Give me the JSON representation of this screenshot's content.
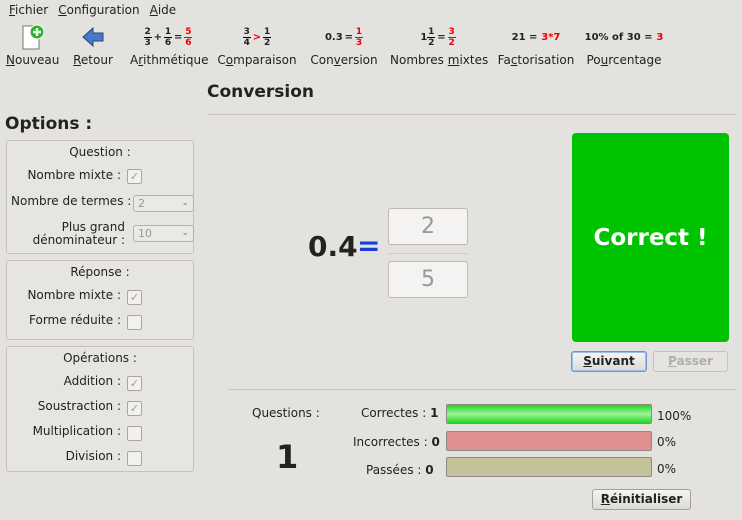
{
  "menu": {
    "items": [
      {
        "first": "F",
        "rest": "ichier"
      },
      {
        "first": "C",
        "rest": "onfiguration"
      },
      {
        "first": "A",
        "rest": "ide"
      }
    ]
  },
  "toolbar": {
    "new_label_first": "N",
    "new_label_rest": "ouveau",
    "back_label_first": "R",
    "back_label_rest": "etour",
    "arith_label_pre": "A",
    "arith_label_u": "r",
    "arith_label_rest": "ithmétique",
    "comp_label_pre": "C",
    "comp_label_u": "o",
    "comp_label_rest": "mparaison",
    "conv_label_pre": "Con",
    "conv_label_u": "v",
    "conv_label_rest": "ersion",
    "mixed_label_pre": "Nombres ",
    "mixed_label_u": "m",
    "mixed_label_rest": "ixtes",
    "fact_label_pre": "Fa",
    "fact_label_u": "c",
    "fact_label_rest": "torisation",
    "pct_label_pre": "Po",
    "pct_label_u": "u",
    "pct_label_rest": "rcentage",
    "arith_icon": {
      "a_num": "2",
      "a_den": "3",
      "plus": "+",
      "b_num": "1",
      "b_den": "6",
      "eq": "=",
      "r_num": "5",
      "r_den": "6"
    },
    "comp_icon": {
      "a_num": "3",
      "a_den": "4",
      "gt": ">",
      "b_num": "1",
      "b_den": "2"
    },
    "conv_icon": {
      "dec": "0.3",
      "eq": "=",
      "r_num": "1",
      "r_den": "3"
    },
    "mixed_icon": {
      "whole": "1",
      "a_num": "1",
      "a_den": "2",
      "eq": "=",
      "r_num": "3",
      "r_den": "2"
    },
    "fact_icon": {
      "left": "21 =",
      "right": "3*7"
    },
    "pct_icon": {
      "left": "10% of 30 =",
      "right": "3"
    }
  },
  "title": "Conversion",
  "options": {
    "title": "Options :",
    "question": {
      "title": "Question :",
      "mixed_label": "Nombre mixte :",
      "mixed_checked": true,
      "terms_label": "Nombre de termes :",
      "terms_value": "2",
      "denom_label_1": "Plus grand",
      "denom_label_2": "dénominateur :",
      "denom_value": "10"
    },
    "answer": {
      "title": "Réponse :",
      "mixed_label": "Nombre mixte :",
      "mixed_checked": true,
      "reduced_label": "Forme réduite :",
      "reduced_checked": false
    },
    "operations": {
      "title": "Opérations :",
      "addition_label": "Addition :",
      "addition_checked": true,
      "subtraction_label": "Soustraction :",
      "subtraction_checked": true,
      "multiplication_label": "Multiplication :",
      "multiplication_checked": false,
      "division_label": "Division :",
      "division_checked": false
    }
  },
  "problem": {
    "decimal": "0.4",
    "equals": "=",
    "numerator": "2",
    "denominator": "5"
  },
  "result": {
    "text": "Correct !",
    "color": "#00c400"
  },
  "buttons": {
    "next_first": "S",
    "next_rest": "uivant",
    "skip_first": "P",
    "skip_rest": "asser",
    "reset_first": "R",
    "reset_rest": "éinitialiser"
  },
  "stats": {
    "questions_label": "Questions :",
    "questions_count": "1",
    "correct_label": "Correctes :",
    "correct_count": "1",
    "correct_pct": "100%",
    "correct_fraction": 1.0,
    "incorrect_label": "Incorrectes :",
    "incorrect_count": "0",
    "incorrect_pct": "0%",
    "incorrect_fraction": 0.0,
    "skipped_label": "Passées :",
    "skipped_count": "0",
    "skipped_pct": "0%",
    "skipped_fraction": 0.0,
    "colors": {
      "correct": "#22d422",
      "incorrect": "#df8f8f",
      "skipped": "#c4c29a"
    }
  }
}
